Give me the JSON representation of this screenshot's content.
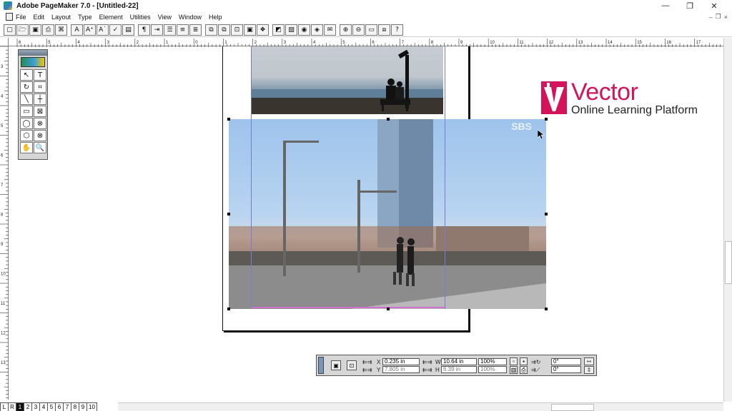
{
  "window": {
    "title": "Adobe PageMaker 7.0 - [Untitled-22]",
    "controls": [
      "—",
      "❐",
      "✕"
    ],
    "doc_controls": [
      "–",
      "❐",
      "×"
    ]
  },
  "menu": {
    "items": [
      "File",
      "Edit",
      "Layout",
      "Type",
      "Element",
      "Utilities",
      "View",
      "Window",
      "Help"
    ]
  },
  "toolbar": {
    "buttons": [
      "▢",
      "🗁",
      "▣",
      "⎙",
      "⌘",
      "A",
      "A⁺",
      "A˙",
      "✓",
      "▤",
      "¶",
      "⇥",
      "☰",
      "≡",
      "≣",
      "⧉",
      "⧉",
      "⊡",
      "▣",
      "❖",
      "◩",
      "▧",
      "◉",
      "◈",
      "✉",
      "⊕",
      "⊖",
      "▭",
      "⧈",
      "?"
    ]
  },
  "ruler": {
    "top_labels": [
      "6",
      "5",
      "4",
      "3",
      "2",
      "1",
      "0",
      "1",
      "2",
      "3",
      "4",
      "5",
      "6",
      "7",
      "8",
      "9",
      "10",
      "11",
      "12",
      "13",
      "14",
      "15",
      "16",
      "17",
      "18"
    ],
    "left_labels": [
      "3",
      "4",
      "5",
      "6",
      "7",
      "8",
      "9",
      "10",
      "11",
      "12",
      "13"
    ]
  },
  "toolbox": {
    "tools": [
      "↖",
      "T",
      "↻",
      "⌗",
      "╲",
      "┼",
      "▭",
      "⊠",
      "◯",
      "⊗",
      "⬡",
      "⊗",
      "✋",
      "🔍"
    ]
  },
  "logo": {
    "word": "Vector",
    "tagline": "Online Learning Platform",
    "color": "#d4145a"
  },
  "image_main": {
    "watermark": "SBS"
  },
  "control_palette": {
    "x_label": "X",
    "x_value": "0.235 in",
    "y_label": "Y",
    "y_value": "7.805 in",
    "w_label": "W",
    "w_value": "10.64 in",
    "h_label": "H",
    "h_value": "6.39 in",
    "scale_w": "100%",
    "scale_h": "100%",
    "rotation": "0°",
    "skew": "0°"
  },
  "pages": {
    "tabs": [
      "L",
      "R",
      "1",
      "2",
      "3",
      "4",
      "5",
      "6",
      "7",
      "8",
      "9",
      "10"
    ],
    "active": "1"
  }
}
